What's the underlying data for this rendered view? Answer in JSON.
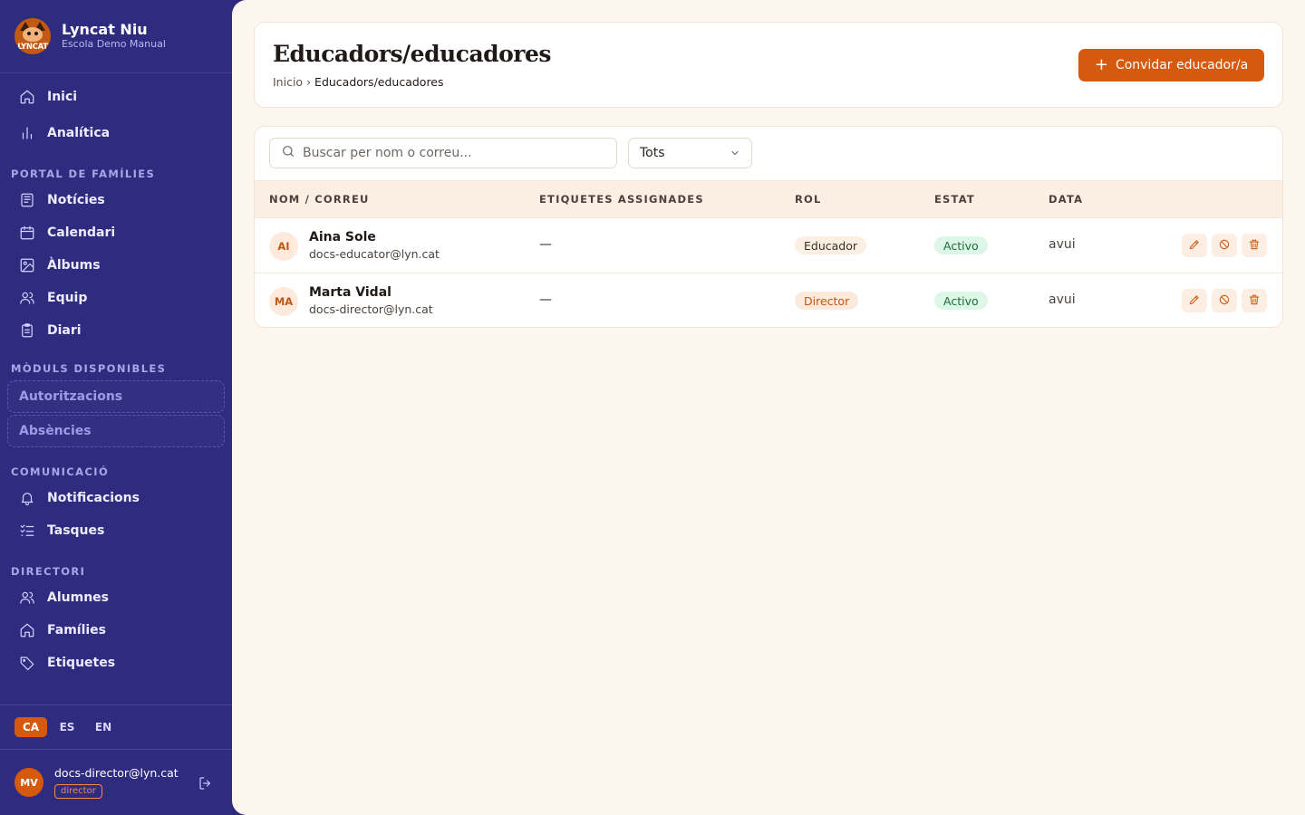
{
  "brand": {
    "name": "Lyncat Niu",
    "school": "Escola Demo Manual",
    "logo_text": "LYNCAT"
  },
  "nav": {
    "main": [
      {
        "label": "Inici",
        "icon": "home-icon"
      },
      {
        "label": "Analítica",
        "icon": "bar-chart-icon"
      }
    ],
    "portal_title": "PORTAL DE FAMÍLIES",
    "portal": [
      {
        "label": "Notícies",
        "icon": "newspaper-icon"
      },
      {
        "label": "Calendari",
        "icon": "calendar-icon"
      },
      {
        "label": "Àlbums",
        "icon": "image-icon"
      },
      {
        "label": "Equip",
        "icon": "users-icon"
      },
      {
        "label": "Diari",
        "icon": "clipboard-icon"
      }
    ],
    "modules_title": "MÒDULS DISPONIBLES",
    "modules": [
      {
        "label": "Autoritzacions"
      },
      {
        "label": "Absències"
      }
    ],
    "comms_title": "COMUNICACIÓ",
    "comms": [
      {
        "label": "Notificacions",
        "icon": "bell-icon"
      },
      {
        "label": "Tasques",
        "icon": "list-checks-icon"
      }
    ],
    "directory_title": "DIRECTORI",
    "directory": [
      {
        "label": "Alumnes",
        "icon": "users-icon"
      },
      {
        "label": "Famílies",
        "icon": "home-icon"
      },
      {
        "label": "Etiquetes",
        "icon": "tag-icon"
      }
    ]
  },
  "languages": [
    {
      "code": "CA",
      "active": true
    },
    {
      "code": "ES",
      "active": false
    },
    {
      "code": "EN",
      "active": false
    }
  ],
  "user": {
    "initials": "MV",
    "email": "docs-director@lyn.cat",
    "role": "director"
  },
  "page": {
    "title": "Educadors/educadores",
    "breadcrumb_home": "Inicio",
    "breadcrumb_sep": "›",
    "breadcrumb_current": "Educadors/educadores",
    "invite_label": "Convidar educador/a"
  },
  "search": {
    "placeholder": "Buscar per nom o correu..."
  },
  "filter": {
    "selected": "Tots"
  },
  "table": {
    "columns": [
      "NOM / CORREU",
      "ETIQUETES ASSIGNADES",
      "ROL",
      "ESTAT",
      "DATA"
    ],
    "rows": [
      {
        "initials": "AI",
        "name": "Aina Sole",
        "email": "docs-educator@lyn.cat",
        "tags": "—",
        "role": "Educador",
        "status": "Activo",
        "date": "avui"
      },
      {
        "initials": "MA",
        "name": "Marta Vidal",
        "email": "docs-director@lyn.cat",
        "tags": "—",
        "role": "Director",
        "status": "Activo",
        "date": "avui"
      }
    ]
  },
  "colors": {
    "sidebar": "#2f2c80",
    "accent": "#d65a0e",
    "background": "#fdf6ef",
    "status_active": "#dcf7e6"
  }
}
